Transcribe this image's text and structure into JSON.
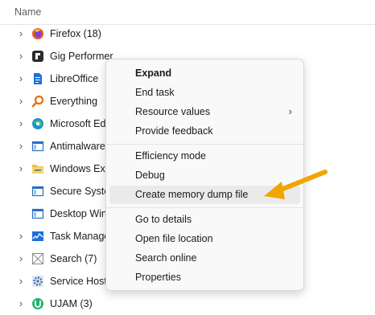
{
  "header": {
    "column_name": "Name"
  },
  "processes": [
    {
      "label": "Firefox (18)",
      "icon": "firefox-icon",
      "expandable": true
    },
    {
      "label": "Gig Performer",
      "icon": "gig-performer-icon",
      "expandable": true
    },
    {
      "label": "LibreOffice",
      "icon": "libreoffice-icon",
      "expandable": true
    },
    {
      "label": "Everything",
      "icon": "everything-search-icon",
      "expandable": true
    },
    {
      "label": "Microsoft Ed",
      "icon": "edge-icon",
      "expandable": true
    },
    {
      "label": "Antimalware",
      "icon": "window-app-icon",
      "expandable": true
    },
    {
      "label": "Windows Exp",
      "icon": "folder-icon",
      "expandable": true
    },
    {
      "label": "Secure Syster",
      "icon": "window-app-icon",
      "expandable": false
    },
    {
      "label": "Desktop Win",
      "icon": "window-app-icon",
      "expandable": false
    },
    {
      "label": "Task Manage",
      "icon": "task-manager-icon",
      "expandable": true
    },
    {
      "label": "Search (7)",
      "icon": "search-app-icon",
      "expandable": true
    },
    {
      "label": "Service Host:",
      "icon": "gear-icon",
      "expandable": true
    },
    {
      "label": "UJAM (3)",
      "icon": "ujam-icon",
      "expandable": true
    }
  ],
  "context_menu": {
    "groups": [
      [
        {
          "label": "Expand",
          "bold": true
        },
        {
          "label": "End task"
        },
        {
          "label": "Resource values",
          "submenu": true
        },
        {
          "label": "Provide feedback"
        }
      ],
      [
        {
          "label": "Efficiency mode"
        },
        {
          "label": "Debug"
        },
        {
          "label": "Create memory dump file",
          "highlighted": true
        }
      ],
      [
        {
          "label": "Go to details"
        },
        {
          "label": "Open file location"
        },
        {
          "label": "Search online"
        },
        {
          "label": "Properties"
        }
      ]
    ]
  },
  "colors": {
    "annotation_arrow": "#f0a500",
    "menu_background": "#f9f9f9",
    "menu_highlight": "#eaeaea"
  }
}
